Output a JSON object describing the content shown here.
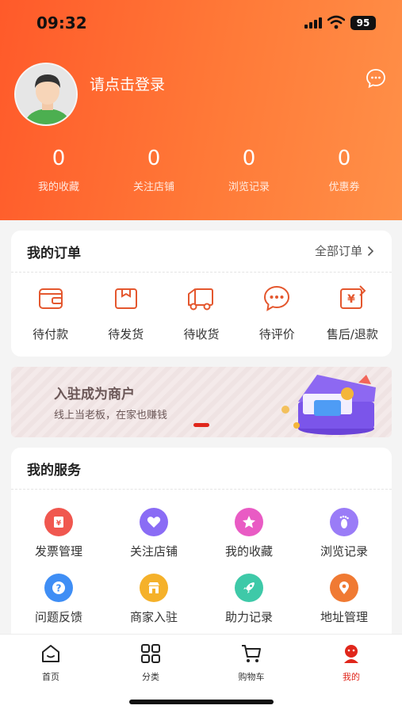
{
  "status_bar": {
    "time": "09:32",
    "battery": "95"
  },
  "profile": {
    "login_prompt": "请点击登录"
  },
  "stats": [
    {
      "value": "0",
      "label": "我的收藏"
    },
    {
      "value": "0",
      "label": "关注店铺"
    },
    {
      "value": "0",
      "label": "浏览记录"
    },
    {
      "value": "0",
      "label": "优惠券"
    }
  ],
  "orders": {
    "title": "我的订单",
    "more": "全部订单",
    "items": [
      {
        "label": "待付款",
        "icon": "wallet-icon"
      },
      {
        "label": "待发货",
        "icon": "package-icon"
      },
      {
        "label": "待收货",
        "icon": "truck-icon"
      },
      {
        "label": "待评价",
        "icon": "comment-icon"
      },
      {
        "label": "售后/退款",
        "icon": "refund-icon"
      }
    ]
  },
  "banner": {
    "title": "入驻成为商户",
    "subtitle": "线上当老板，在家也赚钱"
  },
  "services": {
    "title": "我的服务",
    "items": [
      {
        "label": "发票管理",
        "icon": "invoice-icon",
        "color": "#f0574f"
      },
      {
        "label": "关注店铺",
        "icon": "heart-icon",
        "color": "#8a6cf5"
      },
      {
        "label": "我的收藏",
        "icon": "star-icon",
        "color": "#e95bc4"
      },
      {
        "label": "浏览记录",
        "icon": "footprint-icon",
        "color": "#9a7cf7"
      },
      {
        "label": "问题反馈",
        "icon": "question-icon",
        "color": "#3f8ef5"
      },
      {
        "label": "商家入驻",
        "icon": "shop-icon",
        "color": "#f5b12a"
      },
      {
        "label": "助力记录",
        "icon": "rocket-icon",
        "color": "#3ec9a8"
      },
      {
        "label": "地址管理",
        "icon": "location-icon",
        "color": "#f07a33"
      }
    ]
  },
  "tabbar": {
    "items": [
      {
        "label": "首页",
        "icon": "home-icon"
      },
      {
        "label": "分类",
        "icon": "category-icon"
      },
      {
        "label": "购物车",
        "icon": "cart-icon"
      },
      {
        "label": "我的",
        "icon": "profile-icon"
      }
    ],
    "active": "我的"
  },
  "colors": {
    "accent": "#ff6a30",
    "active_tab": "#e0261b",
    "icon_stroke": "#e4572e"
  }
}
